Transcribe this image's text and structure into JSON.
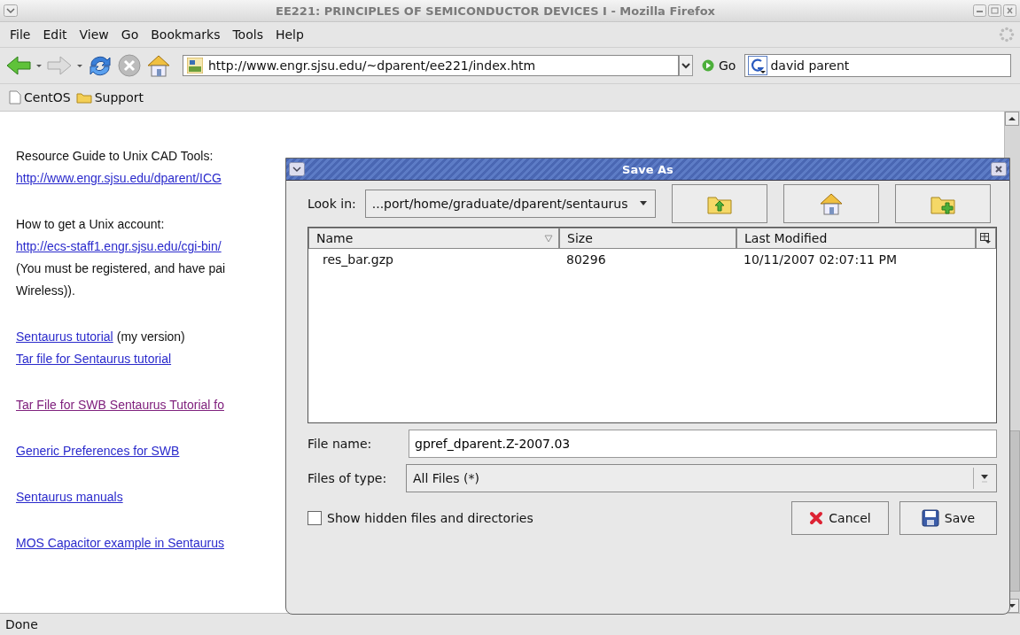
{
  "window": {
    "title": "EE221: PRINCIPLES OF SEMICONDUCTOR DEVICES I - Mozilla Firefox"
  },
  "menu": [
    "File",
    "Edit",
    "View",
    "Go",
    "Bookmarks",
    "Tools",
    "Help"
  ],
  "toolbar": {
    "url": "http://www.engr.sjsu.edu/~dparent/ee221/index.htm",
    "go": "Go",
    "search": "david parent"
  },
  "bookmarks": [
    {
      "label": "CentOS",
      "kind": "page"
    },
    {
      "label": "Support",
      "kind": "folder"
    }
  ],
  "content": [
    [
      [
        {
          "text": "Resource Guide to Unix CAD Tools:",
          "kind": "plain"
        }
      ],
      [
        {
          "text": "http://www.engr.sjsu.edu/dparent/ICG",
          "kind": "link"
        }
      ]
    ],
    [
      [
        {
          "text": "How to get a Unix account:",
          "kind": "plain"
        }
      ],
      [
        {
          "text": "http://ecs-staff1.engr.sjsu.edu/cgi-bin/",
          "kind": "link"
        }
      ],
      [
        {
          "text": "(You must be registered, and have pai",
          "kind": "plain"
        }
      ],
      [
        {
          "text": "Wireless)).",
          "kind": "plain"
        }
      ]
    ],
    [
      [
        {
          "text": "Sentaurus tutorial",
          "kind": "link"
        },
        {
          "text": "(my version)",
          "kind": "plain"
        }
      ],
      [
        {
          "text": "Tar file for Sentaurus tutorial",
          "kind": "link"
        }
      ]
    ],
    [
      [
        {
          "text": "Tar File for SWB Sentaurus Tutorial fo",
          "kind": "visited"
        }
      ]
    ],
    [
      [
        {
          "text": "Generic Preferences for SWB",
          "kind": "link"
        }
      ]
    ],
    [
      [
        {
          "text": "Sentaurus manuals",
          "kind": "link"
        }
      ]
    ],
    [
      [
        {
          "text": "MOS Capacitor example in Sentaurus",
          "kind": "link"
        }
      ]
    ]
  ],
  "status_bar": "Done",
  "dialog": {
    "title": "Save As",
    "look_in_label": "Look in:",
    "look_in": "...port/home/graduate/dparent/sentaurus",
    "columns": [
      {
        "label": "Name",
        "sorted": true
      },
      {
        "label": "Size",
        "sorted": false
      },
      {
        "label": "Last Modified",
        "sorted": false
      }
    ],
    "files": [
      {
        "name": "res_bar.gzp",
        "size": "80296",
        "modified": "10/11/2007 02:07:11 PM"
      }
    ],
    "file_name_label": "File name:",
    "file_name": "gpref_dparent.Z-2007.03",
    "type_label": "Files of type:",
    "type": "All Files (*)",
    "show_hidden": {
      "label": "Show hidden files and directories",
      "checked": false
    },
    "buttons": [
      {
        "label": "Cancel",
        "kind": "cancel"
      },
      {
        "label": "Save",
        "kind": "save"
      }
    ]
  }
}
